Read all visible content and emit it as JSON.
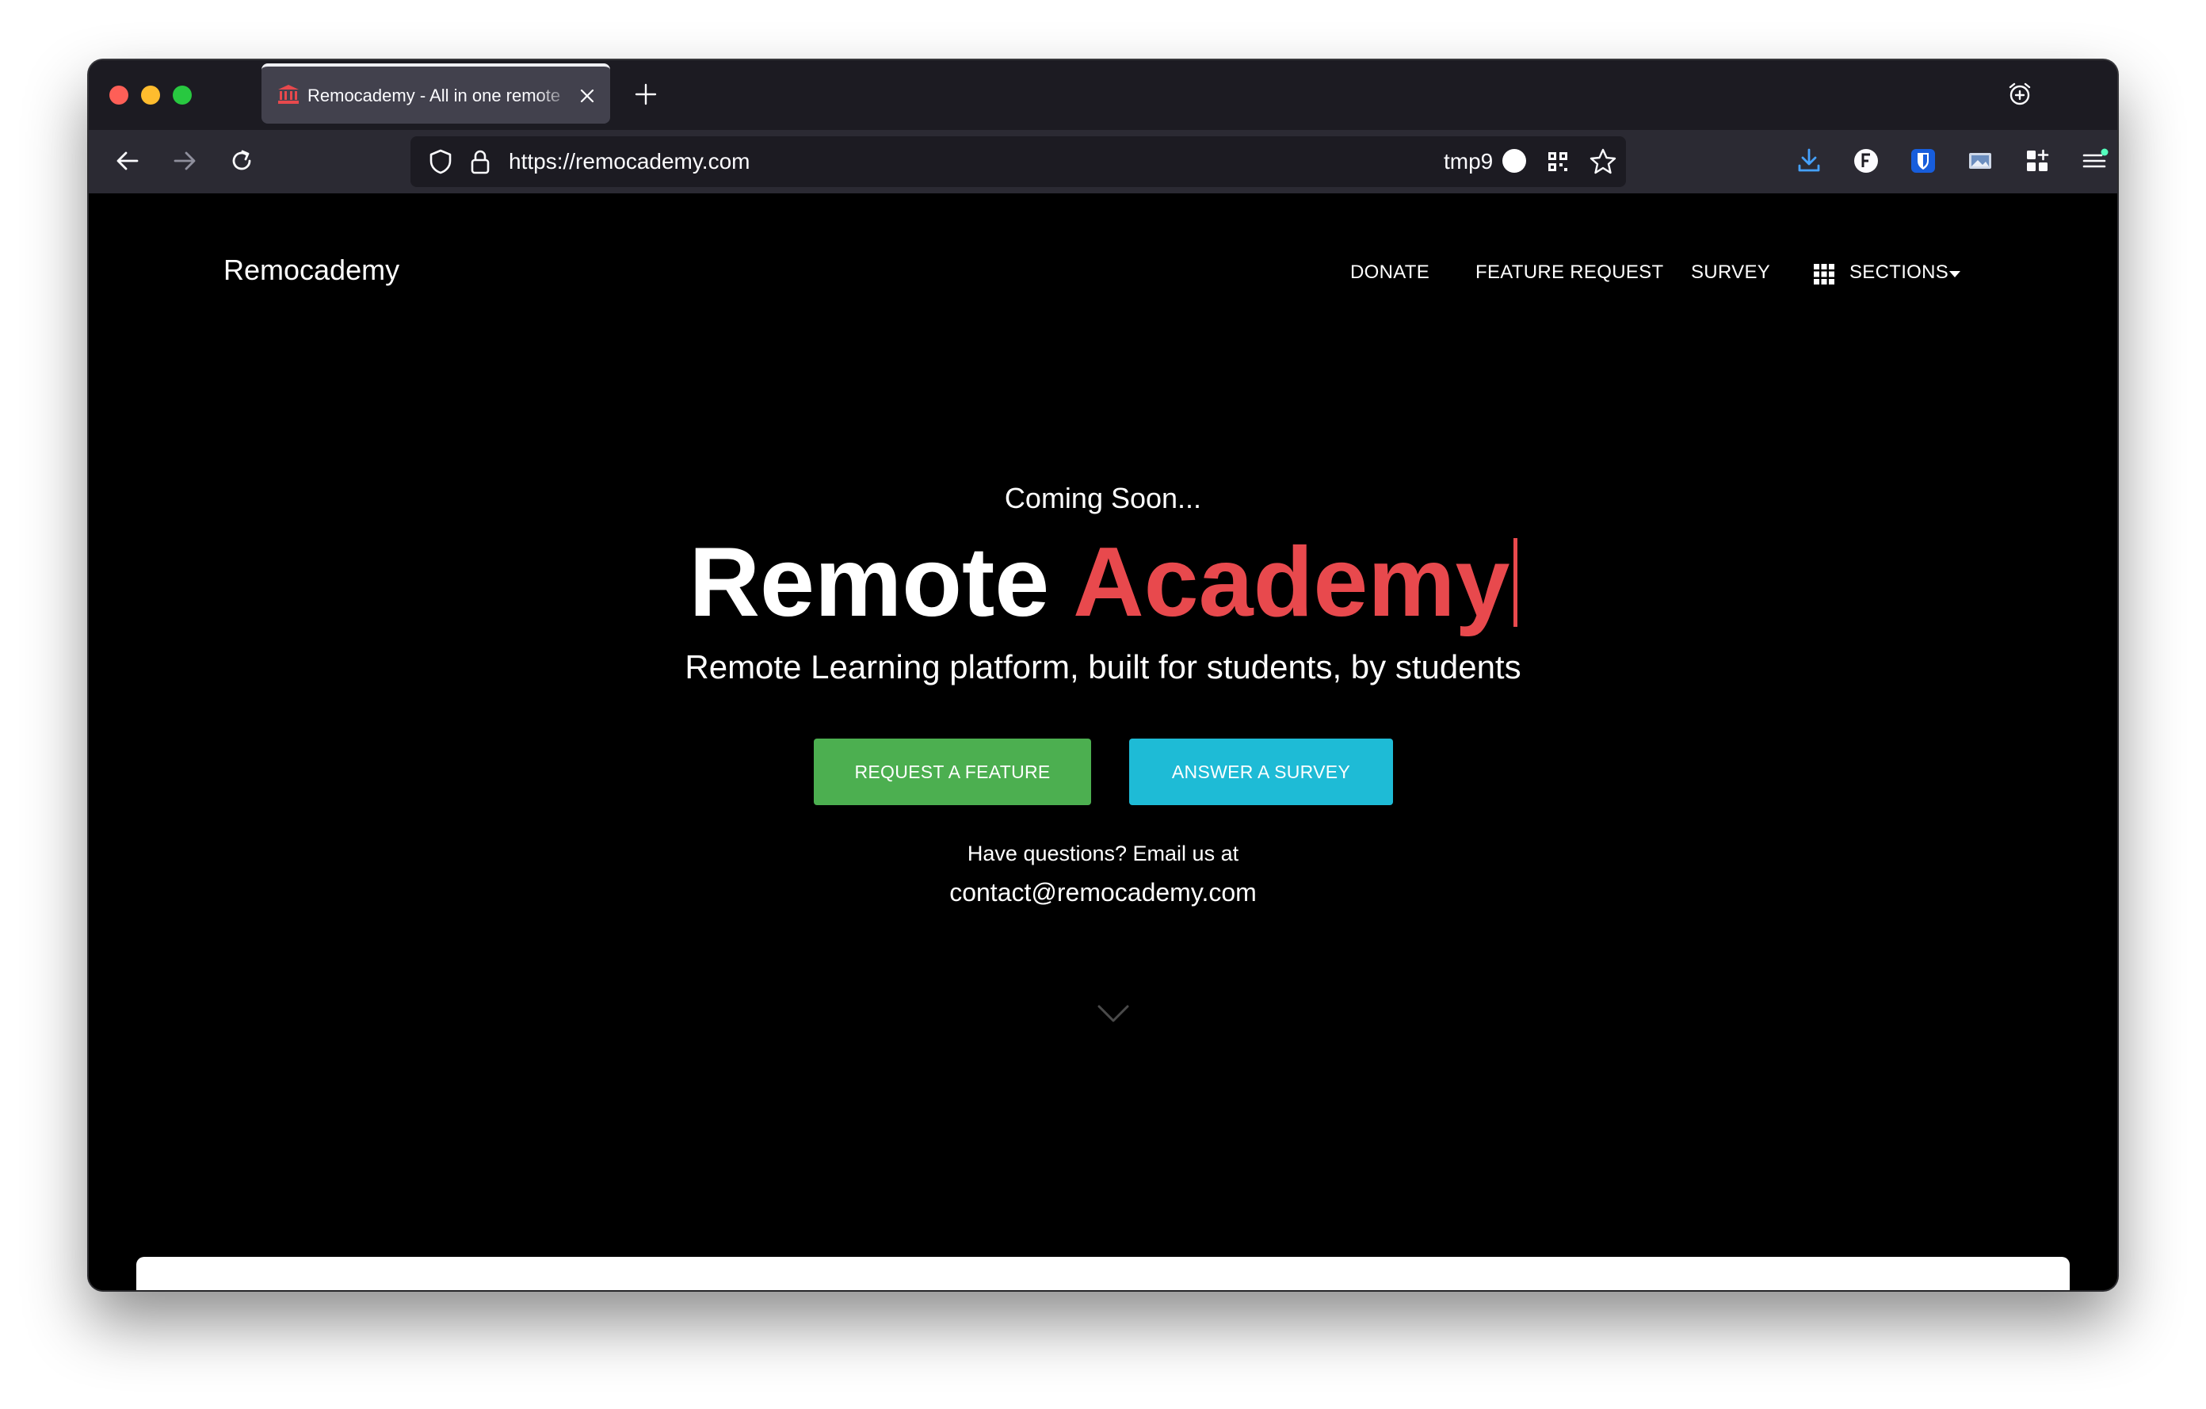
{
  "browser": {
    "tab": {
      "title": "Remocademy - All in one remote"
    },
    "url": "https://remocademy.com",
    "container_label": "tmp9"
  },
  "site": {
    "brand": "Remocademy",
    "nav": [
      "DONATE",
      "FEATURE REQUEST",
      "SURVEY",
      "SECTIONS"
    ]
  },
  "hero": {
    "pre_title": "Coming Soon...",
    "title_part1": "Remote",
    "title_part2": "Academy",
    "subtitle": "Remote Learning platform, built for students, by students",
    "buttons": [
      "REQUEST A FEATURE",
      "ANSWER A SURVEY"
    ],
    "contact_question": "Have questions? Email us at",
    "contact_email": "contact@remocademy.com"
  },
  "colors": {
    "accent_red": "#e8494d",
    "button_green": "#4caf50",
    "button_blue": "#1ebbd6",
    "page_background": "#000000"
  },
  "icons": {
    "tab_favicon": "building-columns-icon",
    "toolbar_right": [
      "download-icon",
      "f-extension-icon",
      "bitwarden-icon",
      "image-extension-icon",
      "add-widget-icon",
      "menu-icon"
    ]
  }
}
